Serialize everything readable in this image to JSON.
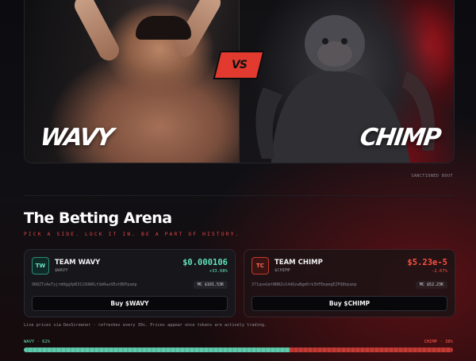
{
  "hero": {
    "left_name": "WAVY",
    "right_name": "CHIMP",
    "vs_label": "VS",
    "caption": "SANCTIONED BOUT"
  },
  "arena": {
    "title": "The Betting Arena",
    "subtitle": "PICK A SIDE. LOCK IT IN. BE A PART OF HISTORY."
  },
  "teams": [
    {
      "avatar": "TW",
      "name": "TEAM WAVY",
      "ticker": "$WAVY",
      "price": "$0.000106",
      "change": "+33.08%",
      "address": "9R8ZTzAeTyjrmHggXpB311XUW6LtSmRwzXEvtBDPpump",
      "mcap": "MC $101.53K",
      "buy_label": "Buy $WAVY",
      "accent": "#5ee3b6"
    },
    {
      "avatar": "TC",
      "name": "TEAM CHIMP",
      "ticker": "$CHIMP",
      "price": "$5.23e-5",
      "change": "-2.67%",
      "address": "371qoeGmtNBNZo14dQzwNgmDrk3hFEmpmgEZPQ8bpump",
      "mcap": "MC $52.23K",
      "buy_label": "Buy $CHIMP",
      "accent": "#ff5040"
    }
  ],
  "footnote": "Live prices via DexScreener · refreshes every 30s. Prices appear once tokens are actively trading.",
  "sentiment": {
    "left_label": "WAVY · 62%",
    "right_label": "CHIMP · 38%",
    "wavy_share": 0.62,
    "chimp_share": 0.38
  }
}
